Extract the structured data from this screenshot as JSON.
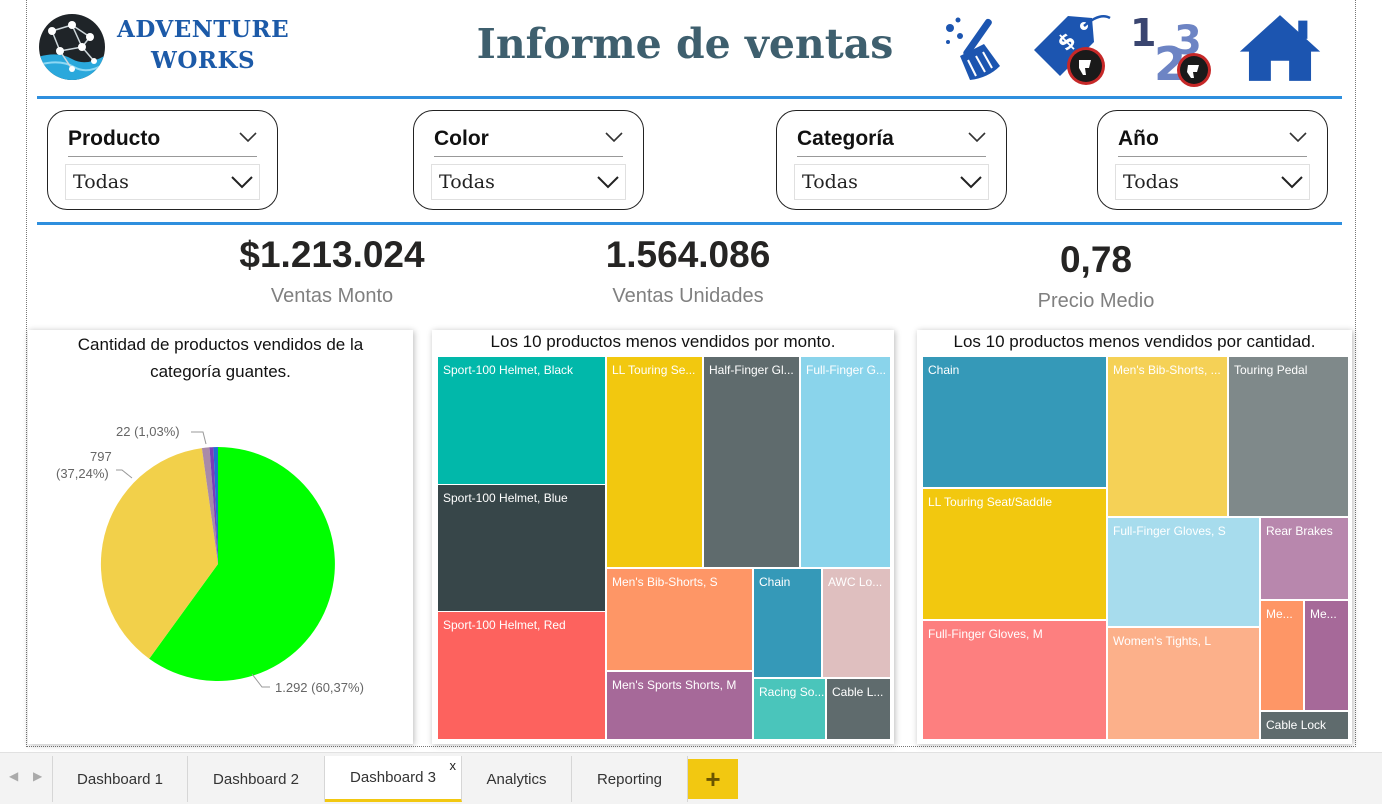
{
  "brand": {
    "line1": "ADVENTURE",
    "line2": "WORKS"
  },
  "report_title": "Informe de ventas",
  "header_icons": [
    "broom-icon",
    "price-tag-dislike-icon",
    "numbers-dislike-icon",
    "home-icon"
  ],
  "colors": {
    "accent_blue": "#2e8fde",
    "brand_blue": "#1c5aa8",
    "title_slate": "#3e5f6e",
    "tab_yellow": "#f2c811"
  },
  "slicers": [
    {
      "title": "Producto",
      "value": "Todas"
    },
    {
      "title": "Color",
      "value": "Todas"
    },
    {
      "title": "Categoría",
      "value": "Todas"
    },
    {
      "title": "Año",
      "value": "Todas"
    }
  ],
  "kpis": [
    {
      "value": "$1.213.024",
      "label": "Ventas Monto"
    },
    {
      "value": "1.564.086",
      "label": "Ventas Unidades"
    },
    {
      "value": "0,78",
      "label": "Precio Medio"
    }
  ],
  "pie": {
    "title_line1": "Cantidad de productos vendidos de la",
    "title_line2": "categoría guantes.",
    "labels": {
      "small": "22 (1,03%)",
      "mid_value": "797",
      "mid_pct": "(37,24%)",
      "big": "1.292 (60,37%)"
    }
  },
  "treemap_amount": {
    "title": "Los 10 productos menos vendidos por monto.",
    "cells": [
      {
        "label": "Sport-100 Helmet, Black",
        "color": "#01b8aa"
      },
      {
        "label": "Sport-100 Helmet, Blue",
        "color": "#374649"
      },
      {
        "label": "Sport-100 Helmet, Red",
        "color": "#fd625e"
      },
      {
        "label": "LL Touring Se...",
        "color": "#f2c80f"
      },
      {
        "label": "Half-Finger Gl...",
        "color": "#5f6b6d"
      },
      {
        "label": "Full-Finger G...",
        "color": "#8ad4eb"
      },
      {
        "label": "Men's Bib-Shorts, S",
        "color": "#fe9666"
      },
      {
        "label": "Men's Sports Shorts, M",
        "color": "#a66999"
      },
      {
        "label": "Chain",
        "color": "#3599b8"
      },
      {
        "label": "AWC Lo...",
        "color": "#dfbfbf"
      },
      {
        "label": "Racing So...",
        "color": "#4ac5bb"
      },
      {
        "label": "Cable L...",
        "color": "#5f6b6d"
      }
    ]
  },
  "treemap_quantity": {
    "title": "Los 10 productos menos vendidos por cantidad.",
    "cells": [
      {
        "label": "Chain",
        "color": "#3599b8"
      },
      {
        "label": "LL Touring Seat/Saddle",
        "color": "#f2c80f"
      },
      {
        "label": "Full-Finger Gloves, M",
        "color": "#fd7f7f"
      },
      {
        "label": "Men's Bib-Shorts, ...",
        "color": "#f5d156"
      },
      {
        "label": "Touring Pedal",
        "color": "#7f898a"
      },
      {
        "label": "Full-Finger Gloves, S",
        "color": "#a7dced"
      },
      {
        "label": "Rear Brakes",
        "color": "#b887ad"
      },
      {
        "label": "Women's Tights, L",
        "color": "#fcb08a"
      },
      {
        "label": "Me...",
        "color": "#fe9666"
      },
      {
        "label": "Me...",
        "color": "#a66999"
      },
      {
        "label": "Cable Lock",
        "color": "#5f6b6d"
      }
    ]
  },
  "tabs": [
    {
      "label": "Dashboard 1",
      "active": false
    },
    {
      "label": "Dashboard 2",
      "active": false
    },
    {
      "label": "Dashboard 3",
      "active": true,
      "close": "x"
    },
    {
      "label": "Analytics",
      "active": false
    },
    {
      "label": "Reporting",
      "active": false
    }
  ],
  "add_tab_label": "+"
}
